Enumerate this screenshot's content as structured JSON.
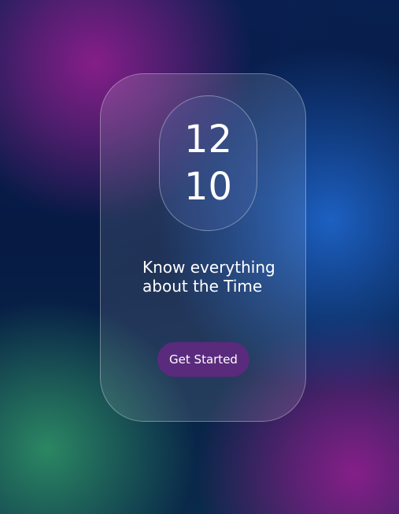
{
  "clock": {
    "hours": "12",
    "minutes": "10"
  },
  "tagline": {
    "line1": "Know everything",
    "line2": "about the Time"
  },
  "cta": {
    "label": "Get Started"
  },
  "colors": {
    "button_bg": "#5a2a7c",
    "text": "#ffffff",
    "background": "#071a45"
  }
}
